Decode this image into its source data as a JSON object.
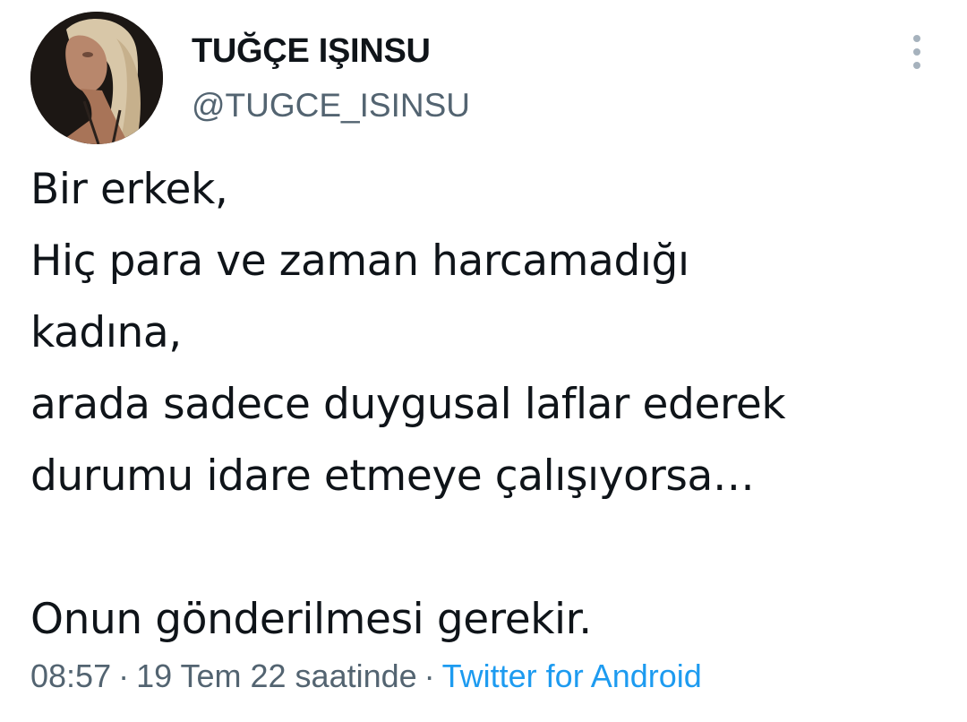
{
  "author": {
    "display_name": "TUĞÇE IŞINSU",
    "handle": "@TUGCE_ISINSU"
  },
  "tweet": {
    "lines": [
      "Bir erkek,",
      "Hiç para ve zaman harcamadığı",
      "kadına,",
      "arada sadece duygusal laflar ederek",
      "durumu idare etmeye çalışıyorsa…",
      "",
      "Onun gönderilmesi gerekir."
    ],
    "time": "08:57",
    "separator": "·",
    "date": "19 Tem 22 saatinde",
    "source": "Twitter for Android"
  },
  "icons": {
    "more": "more-vertical-icon"
  },
  "colors": {
    "text": "#0f1419",
    "secondary": "#536471",
    "link": "#1d9bf0"
  }
}
